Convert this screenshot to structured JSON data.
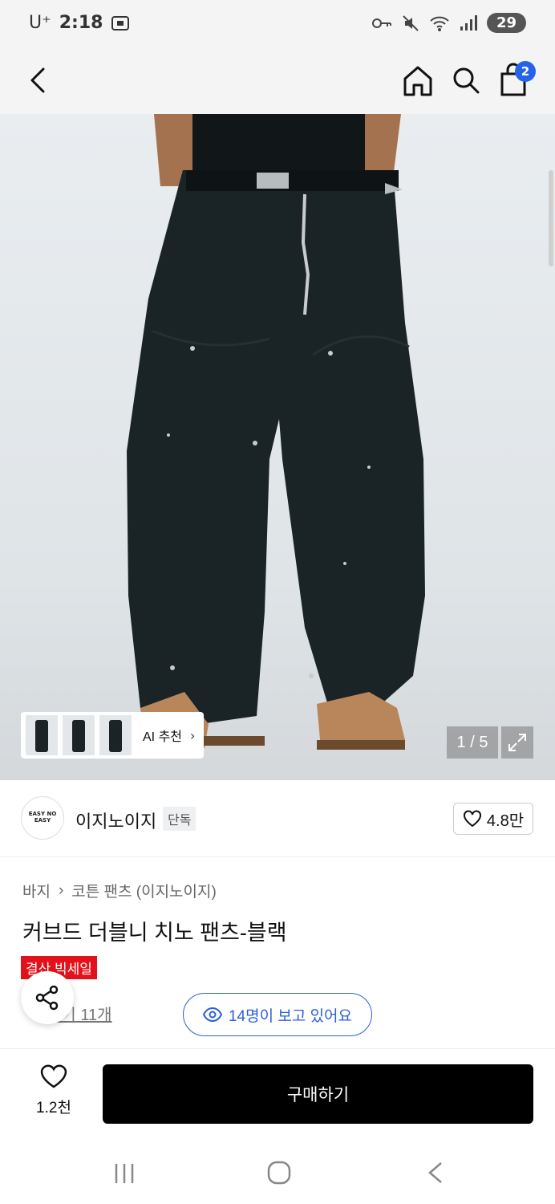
{
  "status_bar": {
    "carrier": "U⁺",
    "time": "2:18",
    "battery": "29"
  },
  "header": {
    "cart_count": "2"
  },
  "gallery": {
    "ai_label": "AI 추천",
    "page_counter": "1 / 5"
  },
  "brand": {
    "logo_text": "EASY NO EASY",
    "name": "이지노이지",
    "tag": "단독",
    "likes": "4.8만"
  },
  "product": {
    "breadcrumb": [
      "바지",
      "코튼 팬츠 (이지노이지)"
    ],
    "title": "커브드 더블니 치노 팬츠-블랙",
    "sale_badge": "결산 빅세일",
    "reviews": "후기 11개",
    "viewers": "14명이 보고 있어요"
  },
  "action_bar": {
    "wish_count": "1.2천",
    "buy_label": "구매하기"
  },
  "colors": {
    "accent_blue": "#2b5fd9",
    "sale_red": "#e3111b",
    "buy_bg": "#000000"
  }
}
